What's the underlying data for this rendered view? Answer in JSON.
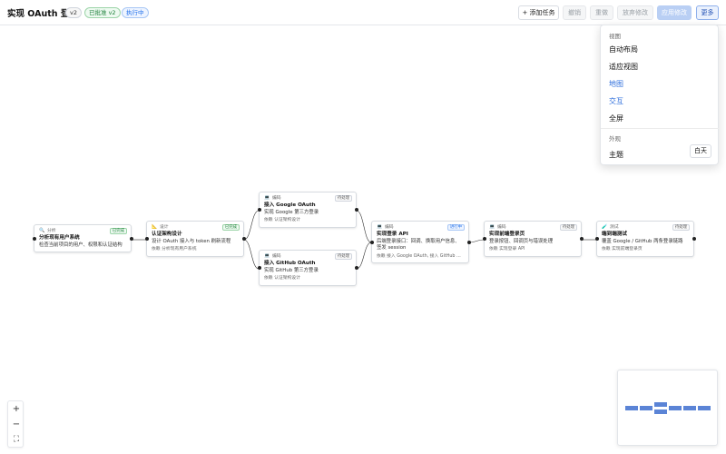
{
  "header": {
    "title": "实现 OAuth 登录",
    "version": "v2",
    "approved": "已批准 v2",
    "status": "执行中",
    "buttons": {
      "add_task": "+ 添加任务",
      "undo": "撤销",
      "redo": "重做",
      "discard": "放弃修改",
      "apply": "应用修改",
      "more": "更多"
    }
  },
  "menu": {
    "view_section": "视图",
    "auto_layout": "自动布局",
    "fit_view": "适应视图",
    "map": "地图",
    "interact": "交互",
    "fullscreen": "全屏",
    "appearance_section": "外观",
    "theme_label": "主题",
    "theme_value": "白天"
  },
  "nodes": [
    {
      "kind": "分析",
      "status": "已完成",
      "title": "分析现有用户系统",
      "desc": "检查当前项目的用户、权限和认证结构",
      "dep": ""
    },
    {
      "kind": "设计",
      "status": "已完成",
      "title": "认证架构设计",
      "desc": "设计 OAuth 接入与 token 刷新流程",
      "dep": "依赖 分析现有用户系统"
    },
    {
      "kind": "编码",
      "status": "待处理",
      "title": "接入 Google OAuth",
      "desc": "实现 Google 第三方登录",
      "dep": "依赖 认证架构设计"
    },
    {
      "kind": "编码",
      "status": "待处理",
      "title": "接入 GitHub OAuth",
      "desc": "实现 GitHub 第三方登录",
      "dep": "依赖 认证架构设计"
    },
    {
      "kind": "编码",
      "status": "进行中",
      "title": "实现登录 API",
      "desc": "后端登录接口：回调、换取用户信息、签发 session",
      "dep": "依赖 接入 Google OAuth, 接入 GitHub OAuth"
    },
    {
      "kind": "编码",
      "status": "待处理",
      "title": "实现前端登录页",
      "desc": "登录按钮、回调页与错误处理",
      "dep": "依赖 实现登录 API"
    },
    {
      "kind": "测试",
      "status": "待处理",
      "title": "端到端测试",
      "desc": "覆盖 Google / GitHub 两条登录链路",
      "dep": "依赖 实现前端登录页"
    }
  ],
  "controls": {
    "zoom_in": "+",
    "zoom_out": "−",
    "fit": "⛶"
  },
  "colors": {
    "accent": "#2f6fdc",
    "done": "#1a7f37",
    "doing": "#1f6feb",
    "minimap_node": "#5b84d6"
  }
}
